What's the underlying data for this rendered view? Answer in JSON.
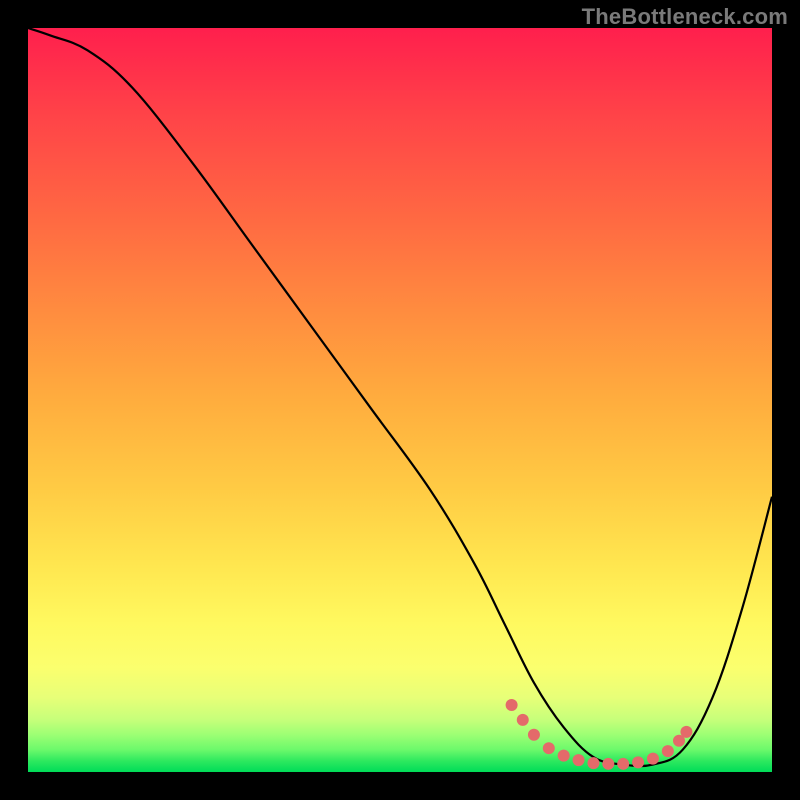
{
  "watermark": "TheBottleneck.com",
  "chart_data": {
    "type": "line",
    "title": "",
    "xlabel": "",
    "ylabel": "",
    "xlim": [
      0,
      100
    ],
    "ylim": [
      0,
      100
    ],
    "grid": false,
    "legend": false,
    "background": {
      "kind": "vertical-gradient",
      "stops": [
        {
          "pos": 0,
          "color": "#ff1f4d"
        },
        {
          "pos": 50,
          "color": "#ffad3e"
        },
        {
          "pos": 80,
          "color": "#fff95f"
        },
        {
          "pos": 100,
          "color": "#00dc58"
        }
      ]
    },
    "series": [
      {
        "name": "bottleneck-curve",
        "color": "#000000",
        "x": [
          0,
          3,
          8,
          14,
          22,
          30,
          38,
          46,
          54,
          60,
          64,
          68,
          72,
          76,
          80,
          84,
          88,
          92,
          96,
          100
        ],
        "y": [
          100,
          99,
          97,
          92,
          82,
          71,
          60,
          49,
          38,
          28,
          20,
          12,
          6,
          2,
          1,
          1,
          3,
          10,
          22,
          37
        ]
      }
    ],
    "markers": [
      {
        "name": "highlight-dots",
        "color": "#e46a6a",
        "radius": 6,
        "x": [
          65,
          66.5,
          68,
          70,
          72,
          74,
          76,
          78,
          80,
          82,
          84,
          86,
          87.5,
          88.5
        ],
        "y": [
          9,
          7,
          5,
          3.2,
          2.2,
          1.6,
          1.2,
          1.1,
          1.1,
          1.3,
          1.8,
          2.8,
          4.2,
          5.4
        ]
      }
    ]
  }
}
